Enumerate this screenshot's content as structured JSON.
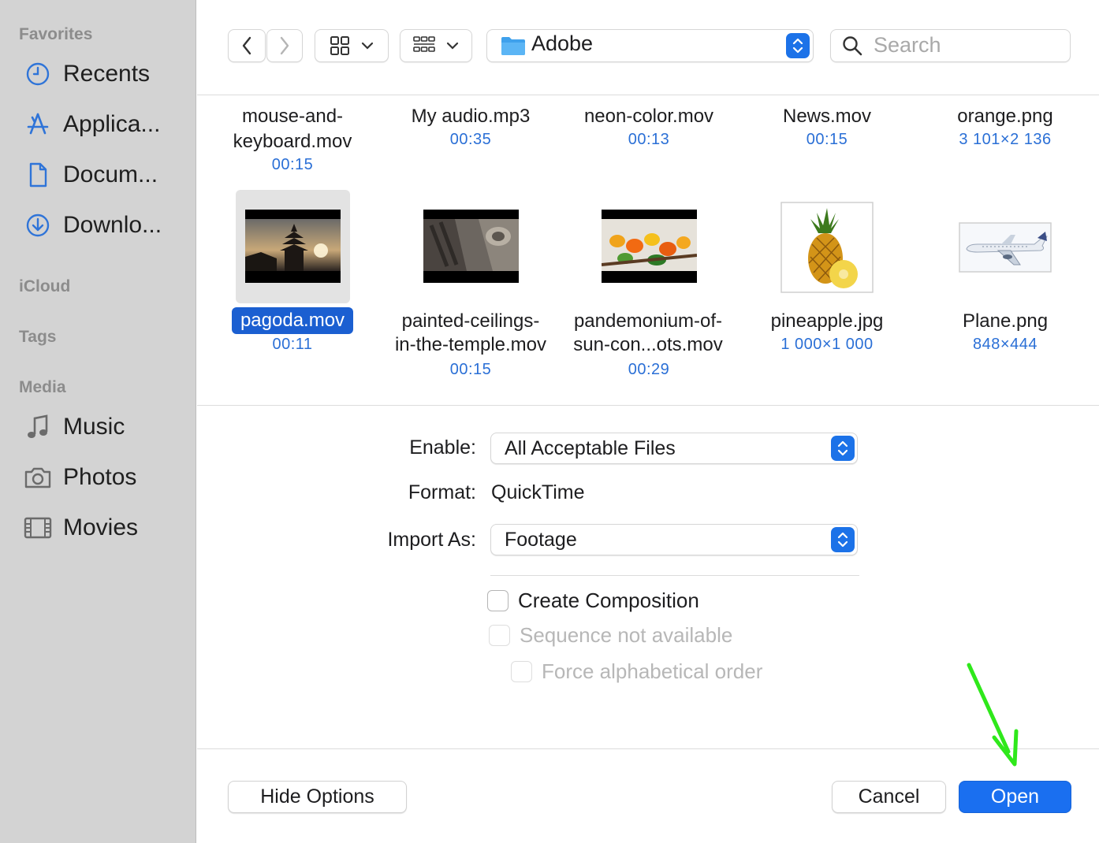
{
  "sidebar": {
    "sections": {
      "favorites": "Favorites",
      "icloud": "iCloud",
      "tags": "Tags",
      "media": "Media"
    },
    "favorites": [
      {
        "label": "Recents",
        "icon": "clock-icon"
      },
      {
        "label": "Applica...",
        "icon": "applications-icon"
      },
      {
        "label": "Docum...",
        "icon": "document-icon"
      },
      {
        "label": "Downlo...",
        "icon": "download-icon"
      }
    ],
    "media": [
      {
        "label": "Music",
        "icon": "music-note-icon"
      },
      {
        "label": "Photos",
        "icon": "camera-icon"
      },
      {
        "label": "Movies",
        "icon": "film-icon"
      }
    ]
  },
  "toolbar": {
    "location": "Adobe",
    "search_placeholder": "Search"
  },
  "files": {
    "row1": [
      {
        "name_line1": "mouse-and-",
        "name_line2": "keyboard.mov",
        "meta": "00:15"
      },
      {
        "name_line1": "My audio.mp3",
        "meta": "00:35"
      },
      {
        "name_line1": "neon-color.mov",
        "meta": "00:13"
      },
      {
        "name_line1": "News.mov",
        "meta": "00:15"
      },
      {
        "name_line1": "orange.png",
        "meta": "3 101×2 136"
      }
    ],
    "row2": [
      {
        "name_line1": "pagoda.mov",
        "meta": "00:11",
        "selected": true
      },
      {
        "name_line1": "painted-ceilings-",
        "name_line2": "in-the-temple.mov",
        "meta": "00:15"
      },
      {
        "name_line1": "pandemonium-of-",
        "name_line2": "sun-con...ots.mov",
        "meta": "00:29"
      },
      {
        "name_line1": "pineapple.jpg",
        "meta": "1 000×1 000"
      },
      {
        "name_line1": "Plane.png",
        "meta": "848×444"
      }
    ]
  },
  "options": {
    "enable_label": "Enable:",
    "enable_value": "All Acceptable Files",
    "format_label": "Format:",
    "format_value": "QuickTime",
    "import_as_label": "Import As:",
    "import_as_value": "Footage",
    "create_composition": "Create Composition",
    "sequence": "Sequence not available",
    "force_alpha": "Force alphabetical order"
  },
  "buttons": {
    "hide_options": "Hide Options",
    "cancel": "Cancel",
    "open": "Open"
  },
  "colors": {
    "accent": "#1a6ff0",
    "annotation_arrow": "#2fe81b"
  }
}
